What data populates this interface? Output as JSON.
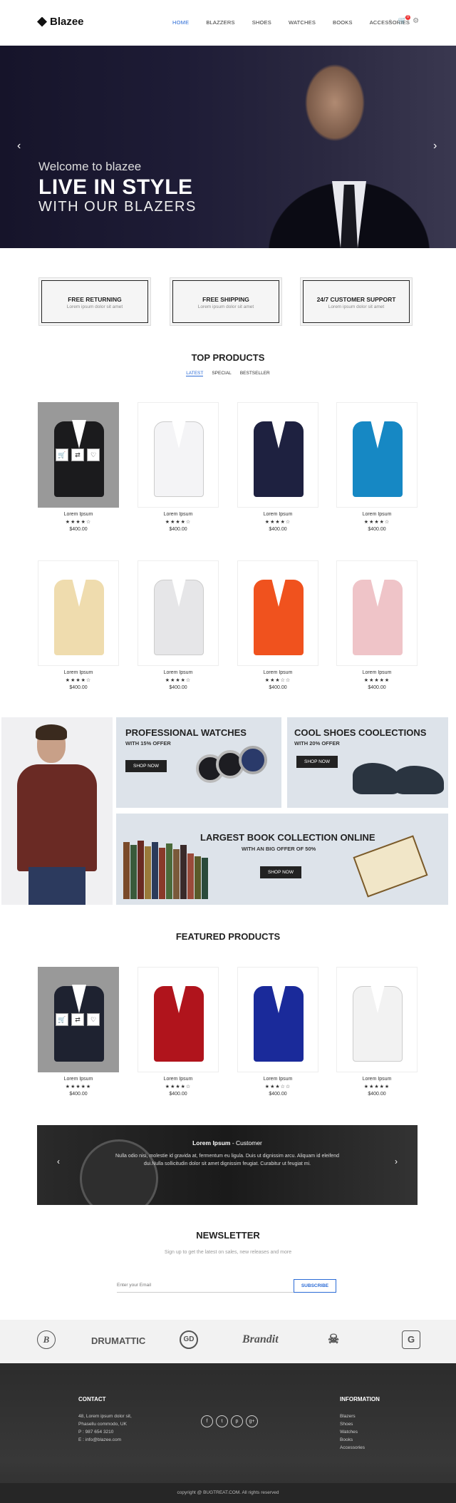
{
  "header": {
    "logo": "Blazee",
    "nav": [
      "HOME",
      "BLAZZERS",
      "SHOES",
      "WATCHES",
      "BOOKS",
      "ACCESSORIES"
    ],
    "icons": [
      "search-icon",
      "cart-icon",
      "settings-icon"
    ],
    "cart_count": "0"
  },
  "hero": {
    "welcome": "Welcome to blazee",
    "title": "LIVE IN STYLE",
    "subtitle": "WITH OUR BLAZERS"
  },
  "features": [
    {
      "title": "FREE RETURNING",
      "text": "Lorem ipsum dolor sit amet"
    },
    {
      "title": "FREE SHIPPING",
      "text": "Lorem ipsum dolor sit amet"
    },
    {
      "title": "24/7 CUSTOMER SUPPORT",
      "text": "Lorem ipsum dolor sit amet"
    }
  ],
  "top_products": {
    "title": "TOP PRODUCTS",
    "tabs": [
      "LATEST",
      "SPECIAL",
      "BESTSELLER"
    ],
    "items": [
      {
        "name": "Lorem Ipsum",
        "stars": "★★★★☆",
        "price": "$400.00",
        "color": "#1b1b1d"
      },
      {
        "name": "Lorem Ipsum",
        "stars": "★★★★☆",
        "price": "$400.00",
        "color": "#f4f4f6"
      },
      {
        "name": "Lorem Ipsum",
        "stars": "★★★★☆",
        "price": "$400.00",
        "color": "#1e2140"
      },
      {
        "name": "Lorem Ipsum",
        "stars": "★★★★☆",
        "price": "$400.00",
        "color": "#1688c4"
      },
      {
        "name": "Lorem Ipsum",
        "stars": "★★★★☆",
        "price": "$400.00",
        "color": "#efdcae"
      },
      {
        "name": "Lorem Ipsum",
        "stars": "★★★★☆",
        "price": "$400.00",
        "color": "#e6e6e8"
      },
      {
        "name": "Lorem Ipsum",
        "stars": "★★★☆☆",
        "price": "$400.00",
        "color": "#f0521e"
      },
      {
        "name": "Lorem Ipsum",
        "stars": "★★★★★",
        "price": "$400.00",
        "color": "#efc4c8"
      }
    ]
  },
  "promos": {
    "watches": {
      "title": "PROFESSIONAL WATCHES",
      "offer": "WITH 15% OFFER",
      "button": "SHOP NOW"
    },
    "shoes": {
      "title": "COOL SHOES COOLECTIONS",
      "offer": "WITH 20% OFFER",
      "button": "SHOP NOW"
    },
    "books": {
      "title": "LARGEST BOOK COLLECTION ONLINE",
      "offer": "WITH AN BIG OFFER OF 50%",
      "button": "SHOP NOW"
    }
  },
  "featured_products": {
    "title": "FEATURED PRODUCTS",
    "items": [
      {
        "name": "Lorem Ipsum",
        "stars": "★★★★★",
        "price": "$400.00",
        "color": "#1e2230"
      },
      {
        "name": "Lorem Ipsum",
        "stars": "★★★★☆",
        "price": "$400.00",
        "color": "#b0141c"
      },
      {
        "name": "Lorem Ipsum",
        "stars": "★★★☆☆",
        "price": "$400.00",
        "color": "#1a2a9a"
      },
      {
        "name": "Lorem Ipsum",
        "stars": "★★★★★",
        "price": "$400.00",
        "color": "#f2f2f2"
      }
    ]
  },
  "testimonial": {
    "name": "Lorem Ipsum",
    "role": " - Customer",
    "text": "Nulla odio nisi, molestie id gravida at, fermentum eu ligula. Duis ut dignissim arcu. Aliquam id eleifend dui.Nulla sollicitudin dolor sit amet dignissim feugiat. Curabitur ut feugiat mi."
  },
  "newsletter": {
    "title": "NEWSLETTER",
    "subtitle": "Sign up to get the latest on sales, new releases and more",
    "placeholder": "Enter your Email",
    "button": "SUBSCRIBE"
  },
  "brands": [
    "B",
    "DRUMATTIC",
    "GD",
    "Brandit",
    "☠",
    "G"
  ],
  "footer": {
    "contact_title": "CONTACT",
    "contact_lines": [
      "48, Lorem ipsum dolor sit,",
      "Phasellu commodo, UK",
      "P : 987 654 3210",
      "E : info@blazee.com"
    ],
    "social": [
      "f",
      "t",
      "p",
      "g+"
    ],
    "info_title": "INFORMATION",
    "info_links": [
      "Blazers",
      "Shoes",
      "Watches",
      "Books",
      "Accessories"
    ],
    "copyright": "copyright @ BUGTREAT.COM. All rights reserved"
  }
}
